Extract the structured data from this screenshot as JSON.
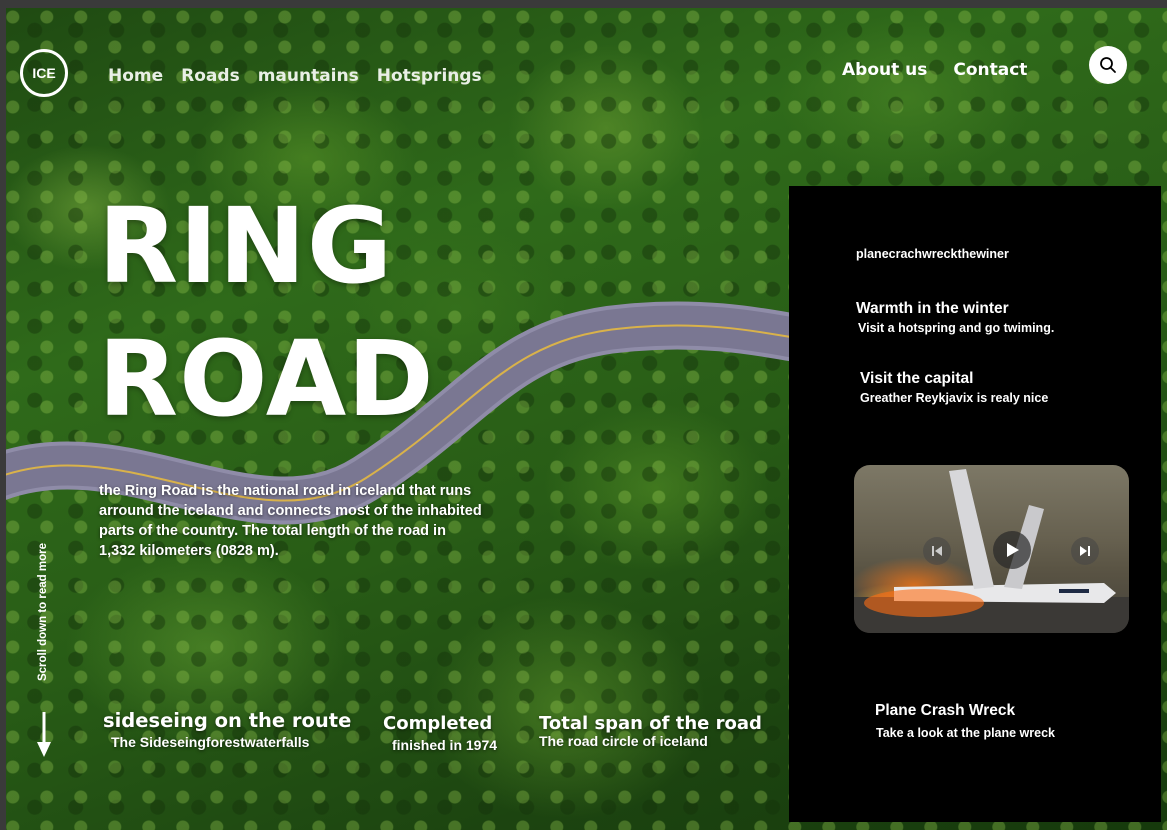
{
  "logo": {
    "text": "ICE"
  },
  "nav": {
    "left": [
      "Home",
      "Roads",
      "mauntains",
      "Hotsprings"
    ],
    "right": [
      "About us",
      "Contact"
    ]
  },
  "hero": {
    "title_line1": "RING",
    "title_line2": "ROAD",
    "description": "the Ring Road is the national road in iceland that runs  arround the iceland and connects most of the inhabited parts of the country. The total length of the road in 1,332 kilometers (0828 m)."
  },
  "scroll_hint": "Scroll down to read more",
  "stats": [
    {
      "title": "sideseing on the route",
      "value": "The Sideseingforestwaterfalls"
    },
    {
      "title": "Completed",
      "value": "finished in 1974"
    },
    {
      "title": "Total span of the road",
      "value": "The road circle of iceland"
    }
  ],
  "panel": {
    "tag": "planecrachwreckthewiner",
    "items": [
      {
        "title": "Warmth in the winter",
        "subtitle": "Visit a hotspring and go twiming."
      },
      {
        "title": "Visit the capital",
        "subtitle": "Greather Reykjavix is realy nice"
      }
    ],
    "feature": {
      "title": "Plane Crash Wreck",
      "subtitle": "Take a look at the plane wreck"
    }
  },
  "colors": {
    "panel_bg": "#000000",
    "forest": "#2f6a1a",
    "text": "#ffffff"
  }
}
